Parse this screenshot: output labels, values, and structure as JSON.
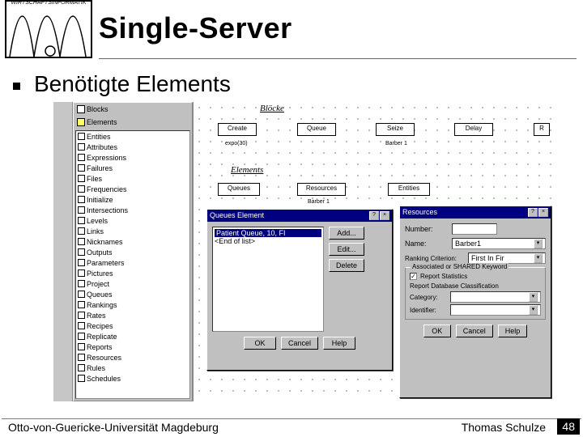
{
  "logo_text": "WIRTSCHAFTSINFORMATIK",
  "title": "Single-Server",
  "subtitle": "Benötigte Elements",
  "footer_left": "Otto-von-Guericke-Universität Magdeburg",
  "footer_right": "Thomas Schulze",
  "page_number": "48",
  "panel": {
    "header_items": [
      "Blocks",
      "Elements"
    ],
    "list": [
      "Entities",
      "Attributes",
      "Expressions",
      "Failures",
      "Files",
      "Frequencies",
      "Initialize",
      "Intersections",
      "Levels",
      "Links",
      "Nicknames",
      "Outputs",
      "Parameters",
      "Pictures",
      "Project",
      "Queues",
      "Rankings",
      "Rates",
      "Recipes",
      "Replicate",
      "Reports",
      "Resources",
      "Rules",
      "Schedules"
    ]
  },
  "canvas": {
    "section_blocks": "Blöcke",
    "section_elements": "Elements",
    "blocks": [
      "Create",
      "Queue",
      "Seize",
      "Delay",
      "R"
    ],
    "sublabel1": "expo(30)",
    "sublabel2": "Barber 1",
    "elements": [
      "Queues",
      "Resources",
      "Entities"
    ],
    "el_sub": "Barber 1"
  },
  "dialog1": {
    "title": "Queues Element",
    "list_selected": "Patient Queue, 10, FI",
    "list_end": "<End of list>",
    "btn_add": "Add...",
    "btn_edit": "Edit...",
    "btn_delete": "Delete",
    "btn_ok": "OK",
    "btn_cancel": "Cancel",
    "btn_help": "Help"
  },
  "dialog2": {
    "title": "Resources",
    "lbl_number": "Number:",
    "lbl_name": "Name:",
    "val_name": "Barber1",
    "lbl_ranking": "Ranking Criterion:",
    "val_ranking": "First In Fir",
    "fieldset_legend": "Associated or SHARED Keyword",
    "chk_report": "Report Statistics",
    "lbl_category": "Report Database Classification",
    "lbl_cat2": "Category:",
    "lbl_id": "Identifier:",
    "btn_ok": "OK",
    "btn_cancel": "Cancel",
    "btn_help": "Help"
  }
}
